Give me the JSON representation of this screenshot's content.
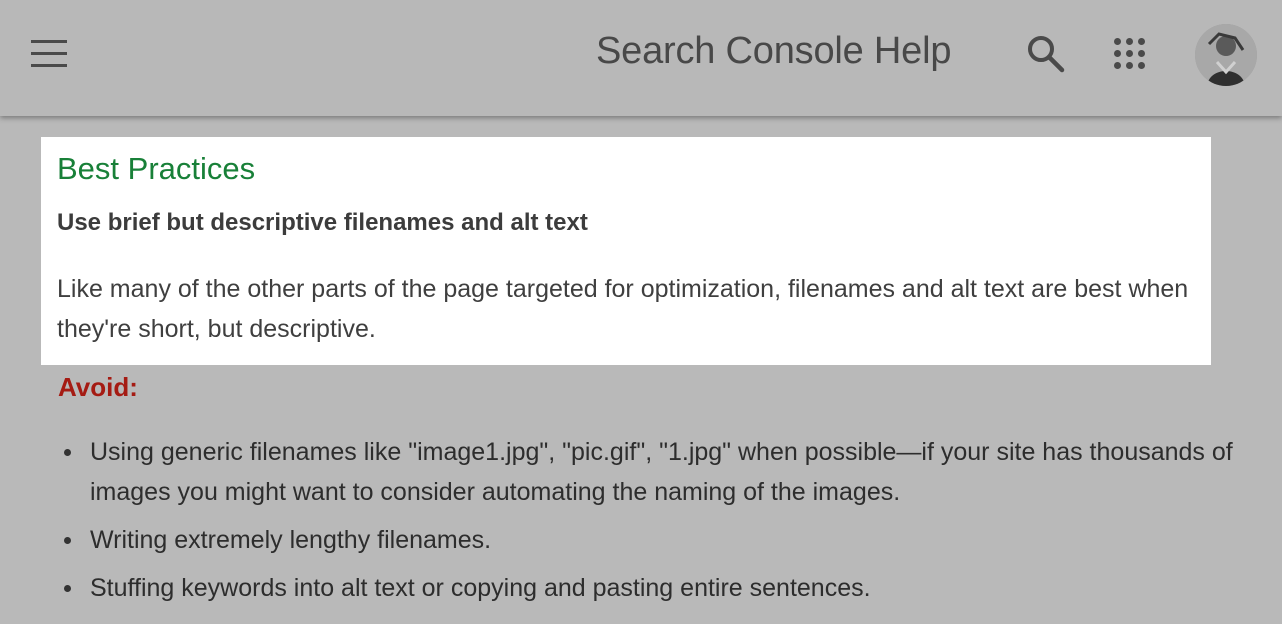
{
  "header": {
    "title": "Search Console Help",
    "menu_icon": "hamburger-menu-icon",
    "search_icon": "search-icon",
    "apps_icon": "apps-grid-icon",
    "avatar_icon": "user-avatar"
  },
  "card": {
    "heading": "Best Practices",
    "subheading": "Use brief but descriptive filenames and alt text",
    "body": "Like many of the other parts of the page targeted for optimization, filenames and alt text are best when they're short, but descriptive."
  },
  "avoid": {
    "heading": "Avoid:",
    "items": [
      "Using generic filenames like \"image1.jpg\", \"pic.gif\", \"1.jpg\" when possible—if your site has thousands of images you might want to consider automating the naming of the images.",
      "Writing extremely lengthy filenames.",
      "Stuffing keywords into alt text or copying and pasting entire sentences."
    ]
  },
  "colors": {
    "heading_green": "#188038",
    "avoid_red": "#a51b13",
    "overlay_gray": "#b9b9b9"
  }
}
